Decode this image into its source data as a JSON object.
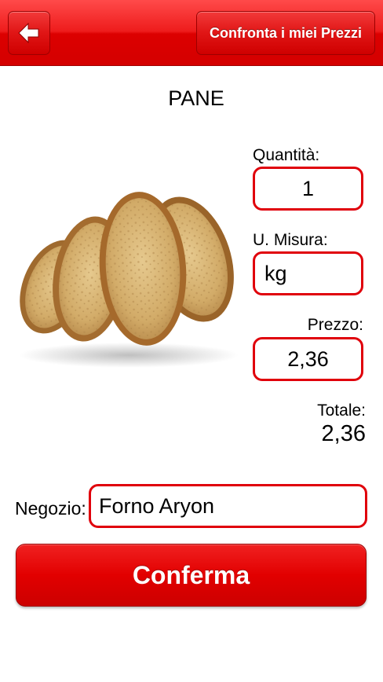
{
  "navbar": {
    "back_icon": "arrow-left-icon",
    "compare_label": "Confronta i miei Prezzi",
    "accent": "#e00000"
  },
  "product": {
    "title": "PANE",
    "image": "bread-slices"
  },
  "form": {
    "quantity_label": "Quantità:",
    "quantity_value": "1",
    "unit_label": "U. Misura:",
    "unit_value": "kg",
    "price_label": "Prezzo:",
    "price_value": "2,36",
    "total_label": "Totale:",
    "total_value": "2,36",
    "shop_label": "Negozio:",
    "shop_value": "Forno Aryon"
  },
  "actions": {
    "confirm_label": "Conferma"
  }
}
